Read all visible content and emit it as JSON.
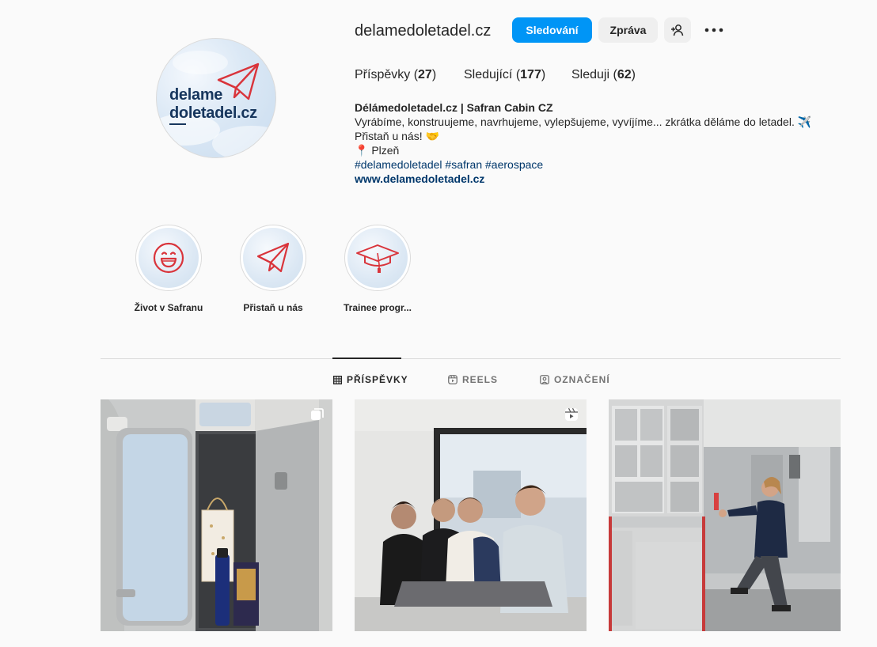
{
  "profile": {
    "username": "delamedoletadel.cz",
    "avatar_logo": {
      "line1": "delame",
      "line2": "doletadel.cz"
    },
    "follow_label": "Sledování",
    "message_label": "Zpráva",
    "add_user_icon": "person-add-icon",
    "more_icon": "more-icon"
  },
  "stats": [
    {
      "label": "Příspěvky",
      "count": "27"
    },
    {
      "label": "Sledující",
      "count": "177"
    },
    {
      "label": "Sleduji",
      "count": "62"
    }
  ],
  "bio": {
    "name": "Délámedoletadel.cz | Safran Cabin CZ",
    "line1": "Vyrábíme, konstruujeme, navrhujeme, vylepšujeme, vyvíjíme... zkrátka děláme do letadel. ✈️",
    "line2": "Přistaň u nás! 🤝",
    "location": "📍 Plzeň",
    "hashtags": "#delamedoletadel #safran #aerospace",
    "link": "www.delamedoletadel.cz"
  },
  "highlights": [
    {
      "label": "Život v Safranu",
      "icon": "smile-icon"
    },
    {
      "label": "Přistaň u nás",
      "icon": "paper-plane-icon"
    },
    {
      "label": "Trainee progr...",
      "icon": "graduation-cap-icon"
    }
  ],
  "tabs": [
    {
      "label": "PŘÍSPĚVKY",
      "icon": "grid-icon",
      "active": true
    },
    {
      "label": "REELS",
      "icon": "reels-icon",
      "active": false
    },
    {
      "label": "OZNAČENÍ",
      "icon": "tagged-icon",
      "active": false
    }
  ],
  "posts": [
    {
      "type": "carousel",
      "icon": "carousel-icon"
    },
    {
      "type": "reel",
      "icon": "reel-icon"
    },
    {
      "type": "photo",
      "icon": ""
    }
  ],
  "colors": {
    "accent": "#0095f6",
    "link": "#00376b",
    "brand_red": "#d9343b",
    "brand_navy": "#17365d"
  }
}
